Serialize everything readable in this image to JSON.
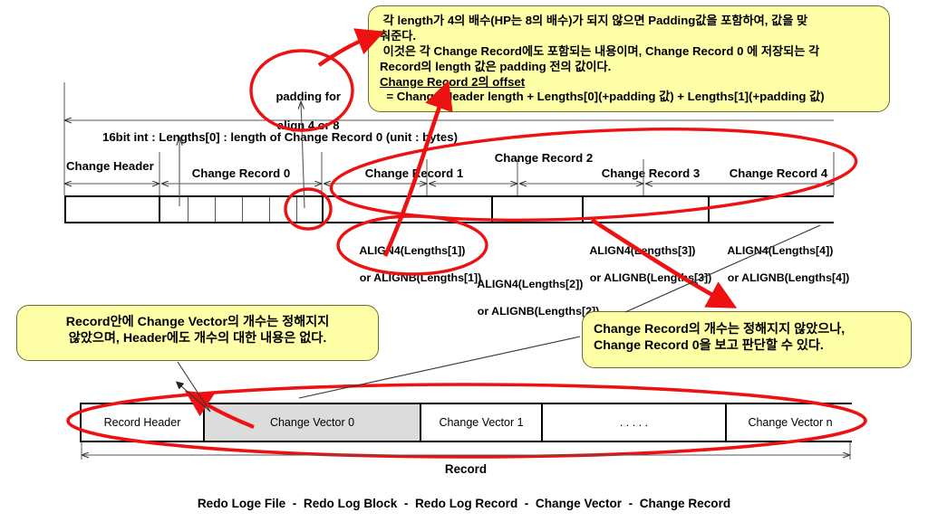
{
  "notes": {
    "top": {
      "lines": [
        " 각 length가 4의 배수(HP는 8의 배수)가 되지 않으면 Padding값을 포함하여, 값을 맞",
        "춰준다.",
        " 이것은 각 Change Record에도 포함되는 내용이며, Change Record 0 에 저장되는 각",
        "Record의 length 값은 padding 전의 값이다."
      ],
      "underlined": "Change Record 2의 offset",
      "formula": "  = Change Header length + Lengths[0](+padding 값) + Lengths[1](+padding 값)"
    },
    "left": {
      "lines": [
        "Record안에 Change Vector의 개수는 정해지지",
        "않았으며, Header에도 개수의 대한 내용은 없다."
      ]
    },
    "right": {
      "lines": [
        "Change Record의 개수는 정해지지 않았으나,",
        "Change Record 0을 보고 판단할 수 있다."
      ]
    }
  },
  "annotations": {
    "padding_circle": {
      "line1": "padding for",
      "line2": "align 4 or 8"
    },
    "length_caption": "16bit int : Lengths[0] : length of Change Record 0 (unit : bytes)",
    "align_labels": [
      {
        "line1": "ALIGN4(Lengths[1])",
        "line2": "or ALIGNB(Lengths[1])"
      },
      {
        "line1": "ALIGN4(Lengths[2])",
        "line2": "or ALIGNB(Lengths[2])"
      },
      {
        "line1": "ALIGN4(Lengths[3])",
        "line2": "or ALIGNB(Lengths[3])"
      },
      {
        "line1": "ALIGN4(Lengths[4])",
        "line2": "or ALIGNB(Lengths[4])"
      }
    ]
  },
  "change_record_bar": {
    "segment_labels": [
      "Change Header",
      "Change Record 0",
      "Change Record 1",
      "Change Record 2",
      "Change Record 3",
      "Change Record 4"
    ]
  },
  "record_bar": {
    "cells": [
      "Record Header",
      "Change Vector 0",
      "Change Vector 1",
      ". . . . .",
      "Change Vector n"
    ],
    "span_label": "Record"
  },
  "footer": "Redo Loge File  -  Redo Log Block  -  Redo Log Record  -  Change Vector  -  Change Record",
  "colors": {
    "note_fill": "#ffffa8",
    "note_border": "#6b6b32",
    "annotation_red": "#ee1111",
    "cell_shaded": "#dcdcdc",
    "bar_stroke": "#000000"
  }
}
